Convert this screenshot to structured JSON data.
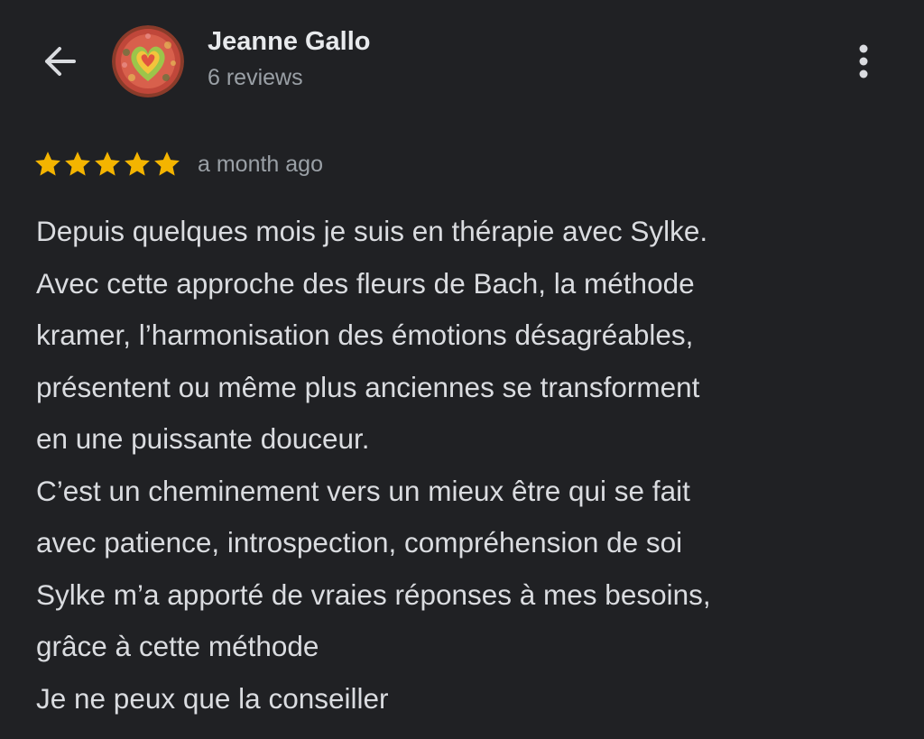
{
  "header": {
    "back_icon": "arrow-back-icon",
    "avatar_icon": "heart-avatar-icon",
    "reviewer_name": "Jeanne Gallo",
    "reviews_count": "6 reviews",
    "more_icon": "more-vert-icon"
  },
  "review": {
    "rating": 5,
    "rating_max": 5,
    "star_icon": "star-icon",
    "star_color": "#f4b400",
    "date": "a month ago",
    "lines": [
      "Depuis quelques mois je suis en thérapie avec Sylke.",
      "Avec cette approche des fleurs de Bach, la méthode",
      "kramer, l’harmonisation des émotions désagréables,",
      "présentent ou même plus anciennes se transforment",
      "en une puissante douceur.",
      "C’est un cheminement vers un mieux être qui se fait",
      "avec patience, introspection, compréhension de soi",
      "Sylke m’a apporté de vraies réponses à mes besoins,",
      "grâce à cette méthode",
      "Je ne peux que la conseiller"
    ]
  },
  "colors": {
    "background": "#202124",
    "primary_text": "#e8eaed",
    "secondary_text": "#9aa0a6",
    "body_text": "#dadce0"
  }
}
